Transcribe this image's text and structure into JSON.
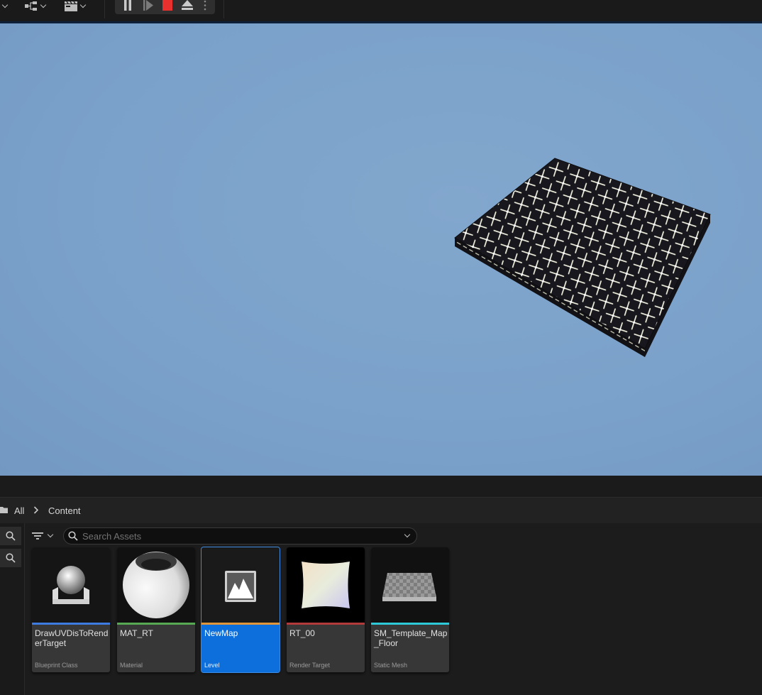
{
  "toolbar": {
    "icons": [
      "transform-icon",
      "snap-hierarchy-icon",
      "cinematics-icon"
    ],
    "play_controls": [
      "pause-icon",
      "skip-frame-icon",
      "stop-icon",
      "eject-icon",
      "more-options-icon"
    ],
    "colors": {
      "stop": "#e8302f"
    }
  },
  "content_browser": {
    "breadcrumb": {
      "root": "All",
      "current": "Content"
    },
    "search": {
      "placeholder": "Search Assets",
      "value": ""
    },
    "assets": [
      {
        "name": "DrawUVDisToRenderTarget",
        "type": "Blueprint Class",
        "color": "#3e7be0"
      },
      {
        "name": "MAT_RT",
        "type": "Material",
        "color": "#57a853"
      },
      {
        "name": "NewMap",
        "type": "Level",
        "color": "#e0953a",
        "selected": true
      },
      {
        "name": "RT_00",
        "type": "Render Target",
        "color": "#b33a3a"
      },
      {
        "name": "SM_Template_Map_Floor",
        "type": "Static Mesh",
        "color": "#2ec9d8"
      }
    ]
  }
}
